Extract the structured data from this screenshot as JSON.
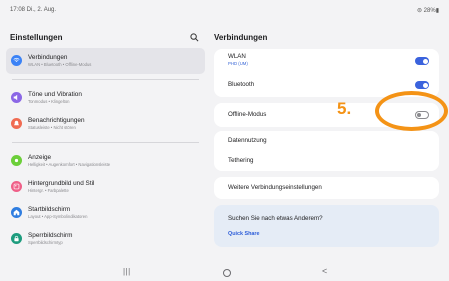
{
  "status_bar": {
    "time": "17:08  Di., 2. Aug.",
    "system": "⊜ 28%▮"
  },
  "left": {
    "title": "Einstellungen",
    "groups": [
      [
        {
          "label": "Verbindungen",
          "sub": "WLAN  •  Bluetooth  •  Offline-Modus",
          "icon": "wifi-icon",
          "color": "#3b82f6"
        }
      ],
      [
        {
          "label": "Töne und Vibration",
          "sub": "Tonmodus  •  Klingelton",
          "icon": "volume-icon",
          "color": "#8b67e6"
        },
        {
          "label": "Benachrichtigungen",
          "sub": "Statusleiste  •  Nicht stören",
          "icon": "bell-icon",
          "color": "#f06b52"
        }
      ],
      [
        {
          "label": "Anzeige",
          "sub": "Helligkeit  •  Augenkomfort  •  Navigationsleiste",
          "icon": "display-icon",
          "color": "#6ccf3a"
        },
        {
          "label": "Hintergrundbild und Stil",
          "sub": "Hintergr.  •  Farbpalette",
          "icon": "wallpaper-icon",
          "color": "#ef5f88"
        },
        {
          "label": "Startbildschirm",
          "sub": "Layout  •  App-Symbolindikatoren",
          "icon": "home-icon",
          "color": "#2f7de0"
        },
        {
          "label": "Sperrbildschirm",
          "sub": "Sperrbildschirmtyp",
          "icon": "lock-icon",
          "color": "#1d9c7e"
        }
      ]
    ]
  },
  "right": {
    "title": "Verbindungen",
    "wlan_label": "WLAN",
    "wlan_sub": "PHD (UM)",
    "bluetooth_label": "Bluetooth",
    "offline_label": "Offline-Modus",
    "data_usage_label": "Datennutzung",
    "tethering_label": "Tethering",
    "more_label": "Weitere Verbindungseinstellungen",
    "suggest_question": "Suchen Sie nach etwas Anderem?",
    "suggest_link": "Quick Share",
    "wlan_on": true,
    "bluetooth_on": true,
    "offline_on": false
  },
  "annotation": {
    "number": "5."
  },
  "navbar": {
    "recents": "|||",
    "back": "<"
  }
}
